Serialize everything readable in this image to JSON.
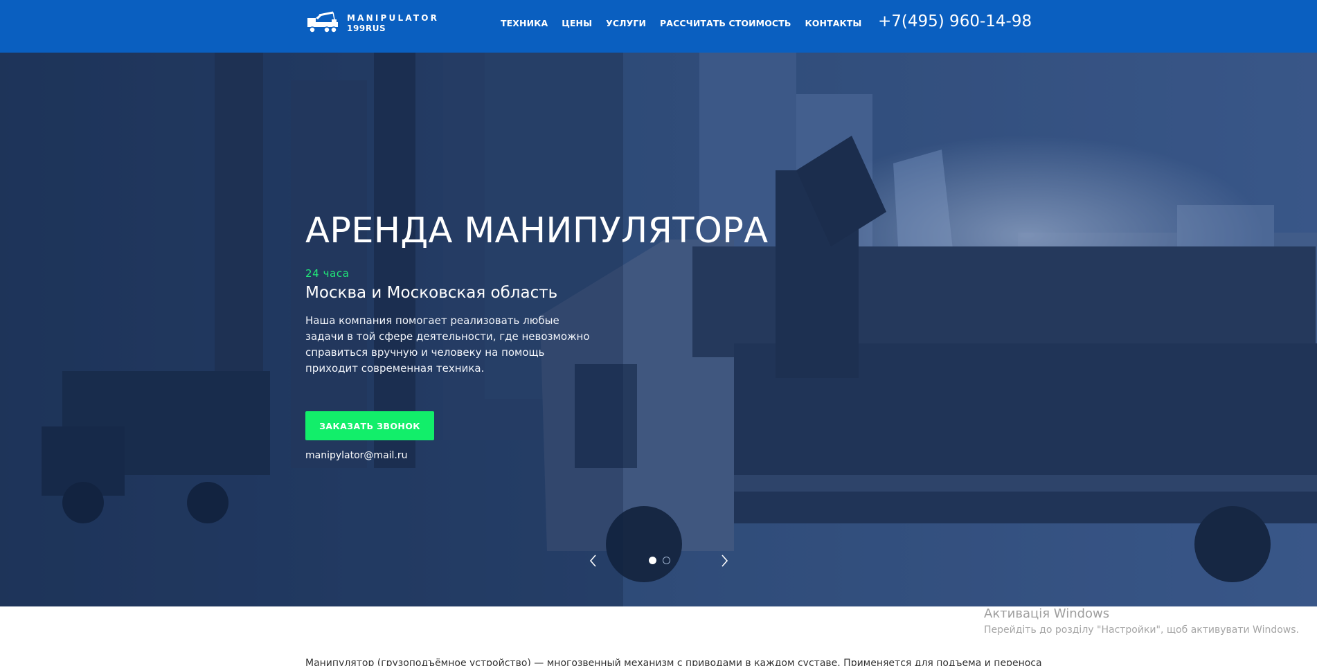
{
  "header": {
    "logo_line1": "MANIPULATOR",
    "logo_line2": "199RUS",
    "nav": [
      {
        "label": "ТЕХНИКА"
      },
      {
        "label": "ЦЕНЫ"
      },
      {
        "label": "УСЛУГИ"
      },
      {
        "label": "РАССЧИТАТЬ СТОИМОСТЬ"
      },
      {
        "label": "КОНТАКТЫ"
      }
    ],
    "phone": "+7(495) 960-14-98"
  },
  "hero": {
    "title": "АРЕНДА МАНИПУЛЯТОРА",
    "tag": "24 часа",
    "subtitle": "Москва и Московская область",
    "description": "Наша компания помогает реализовать любые задачи в той сфере деятельности, где невозможно справиться вручную и человеку на помощь приходит современная техника.",
    "cta_label": "ЗАКАЗАТЬ ЗВОНОК",
    "email": "manipylator@mail.ru",
    "slides_total": 2,
    "active_slide": 1
  },
  "below": {
    "text": "Манипулятор (грузоподъёмное устройство) — многозвенный механизм с приводами в каждом суставе. Применяется для подъема и переноса"
  },
  "watermark": {
    "title": "Активація Windows",
    "subtitle": "Перейдіть до розділу \"Настройки\", щоб активувати Windows."
  },
  "colors": {
    "header_bg": "#0a5fc0",
    "accent_green": "#12ee6a",
    "tag_green": "#21e879"
  },
  "icons": {
    "logo": "crane-truck-icon",
    "prev": "chevron-left-icon",
    "next": "chevron-right-icon"
  }
}
